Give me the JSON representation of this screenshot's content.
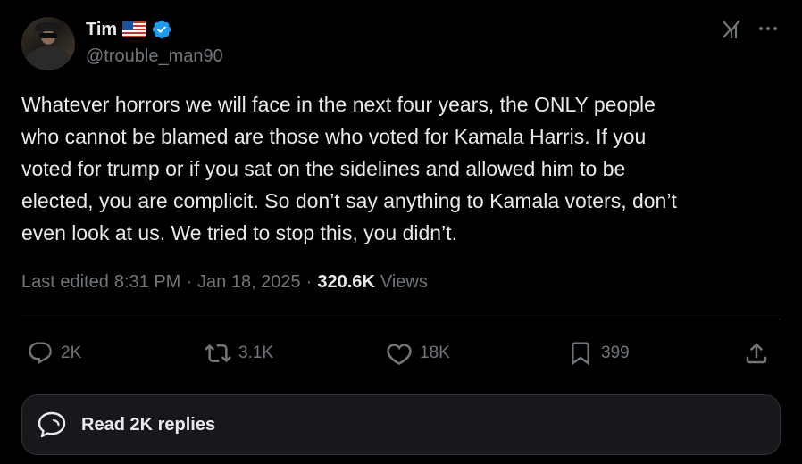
{
  "author": {
    "display_name": "Tim",
    "handle": "@trouble_man90",
    "flag_icon": "us-flag-icon",
    "verified_icon": "verified-badge-icon",
    "verified_color": "#1d9bf0"
  },
  "tweet": {
    "text": "Whatever horrors we will face in the next four years, the ONLY people\nwho cannot be blamed are those who voted for Kamala Harris. If you\nvoted for trump or if you sat on the sidelines and allowed him to be\nelected, you are complicit. So don’t say anything to Kamala voters, don’t\neven look at us. We tried to stop this, you didn’t."
  },
  "meta": {
    "edited_label": "Last edited",
    "time": "8:31 PM",
    "separator": "·",
    "date": "Jan 18, 2025",
    "views_count": "320.6K",
    "views_label": "Views"
  },
  "actions": {
    "replies": "2K",
    "reposts": "3.1K",
    "likes": "18K",
    "bookmarks": "399"
  },
  "read_replies": {
    "label": "Read 2K replies"
  },
  "colors": {
    "background": "#000000",
    "text_primary": "#e7e9ea",
    "text_secondary": "#71767b",
    "border": "#2f3336"
  }
}
